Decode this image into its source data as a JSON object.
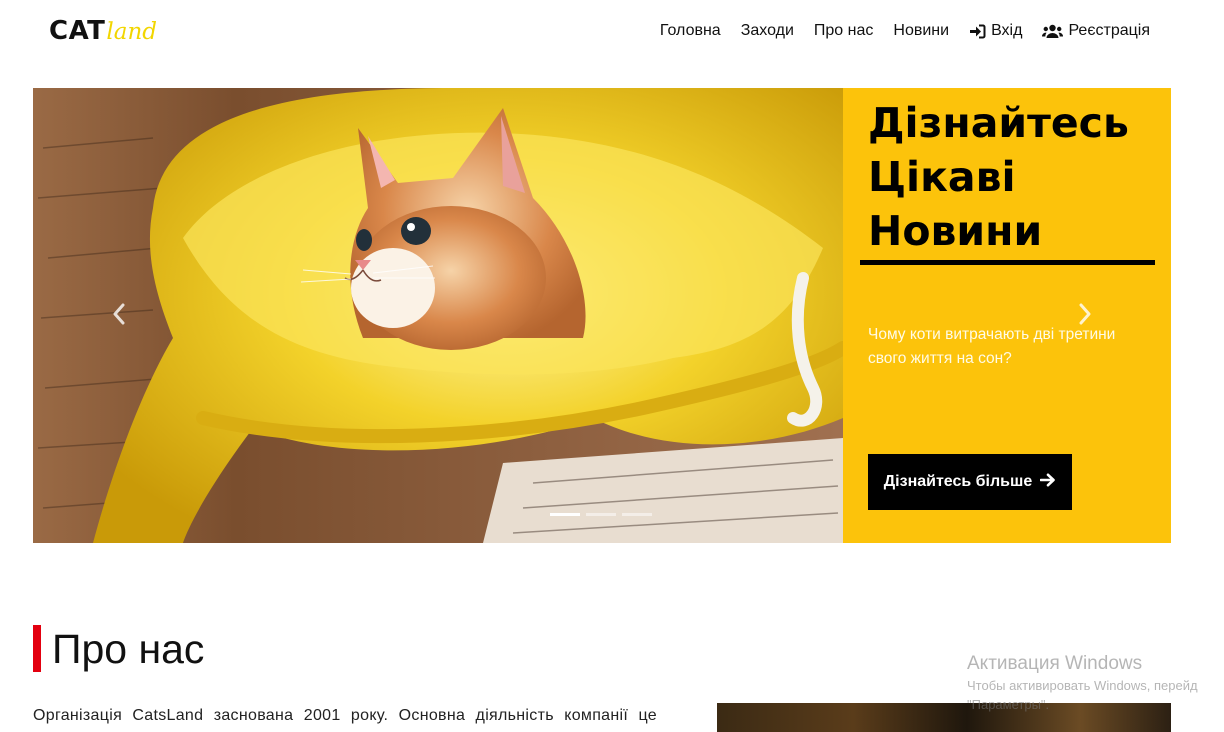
{
  "header": {
    "logo_main": "CAT",
    "logo_sub": "land",
    "nav": [
      {
        "label": "Головна"
      },
      {
        "label": "Заходи"
      },
      {
        "label": "Про нас"
      },
      {
        "label": "Новини"
      },
      {
        "label": "Вхід",
        "icon": "sign-in-icon"
      },
      {
        "label": "Реєстрація",
        "icon": "users-icon"
      }
    ]
  },
  "hero": {
    "title": "Дізнайтесь Цікаві Новини",
    "text": "Чому коти витрачають дві третини свого життя на сон?",
    "button_label": "Дізнайтесь більше",
    "button_icon": "arrow-right-icon",
    "slides_count": 3,
    "active_slide": 1,
    "accent_color": "#fcc30b"
  },
  "about": {
    "title": "Про нас",
    "text": "Організація CatsLand заснована 2001 року. Основна діяльність компанії це",
    "accent_color": "#e3000f"
  },
  "watermark": {
    "title": "Активация Windows",
    "line1": "Чтобы активировать Windows, перейд",
    "line2": "\"Параметры\"."
  }
}
